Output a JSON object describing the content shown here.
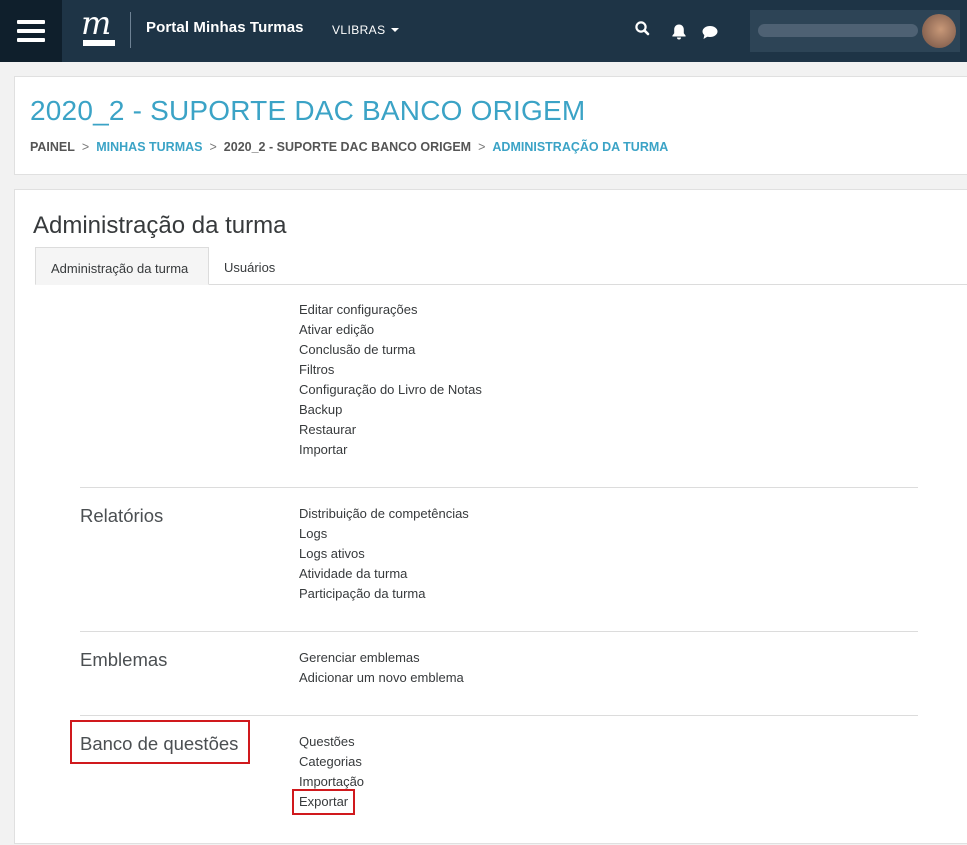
{
  "navbar": {
    "brand": "Portal Minhas Turmas",
    "language": "VLIBRAS",
    "logo_letter": "m",
    "icons": [
      "menu-icon",
      "search-icon",
      "bell-icon",
      "chat-icon"
    ]
  },
  "header": {
    "title": "2020_2 - SUPORTE DAC BANCO ORIGEM",
    "breadcrumb": {
      "painel": "PAINEL",
      "minhas_turmas": "MINHAS TURMAS",
      "course": "2020_2 - SUPORTE DAC BANCO ORIGEM",
      "current": "ADMINISTRAÇÃO DA TURMA",
      "separator": ">"
    }
  },
  "main": {
    "heading": "Administração da turma",
    "tabs": [
      {
        "label": "Administração da turma"
      },
      {
        "label": "Usuários"
      }
    ],
    "general_links": [
      "Editar configurações",
      "Ativar edição",
      "Conclusão de turma",
      "Filtros",
      "Configuração do Livro de Notas",
      "Backup",
      "Restaurar",
      "Importar"
    ],
    "relatorios": {
      "title": "Relatórios",
      "links": [
        "Distribuição de competências",
        "Logs",
        "Logs ativos",
        "Atividade da turma",
        "Participação da turma"
      ]
    },
    "emblemas": {
      "title": "Emblemas",
      "links": [
        "Gerenciar emblemas",
        "Adicionar um novo emblema"
      ]
    },
    "banco": {
      "title": "Banco de questões",
      "links": [
        "Questões",
        "Categorias",
        "Importação",
        "Exportar"
      ]
    }
  },
  "colors": {
    "navbar": "#1e3446",
    "accent": "#3ba3c6",
    "highlight": "#d0191d"
  }
}
